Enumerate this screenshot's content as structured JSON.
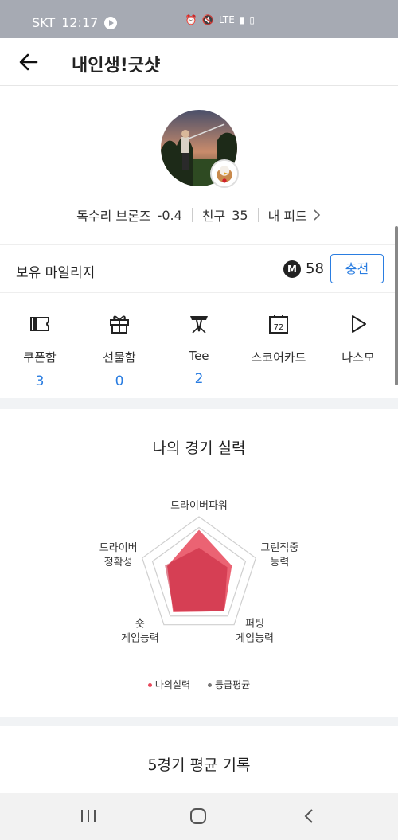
{
  "status": {
    "carrier": "SKT",
    "time": "12:17",
    "network": "LTE"
  },
  "header": {
    "title": "내인생!긋샷"
  },
  "profile": {
    "grade": "독수리 브론즈",
    "grade_value": "-0.4",
    "friends_label": "친구",
    "friends_count": "35",
    "feed_label": "내 피드"
  },
  "mileage": {
    "label": "보유 마일리지",
    "icon_letter": "M",
    "value": "58",
    "charge_label": "충전"
  },
  "menu": [
    {
      "icon": "ticket-icon",
      "label": "쿠폰함",
      "count": "3"
    },
    {
      "icon": "gift-icon",
      "label": "선물함",
      "count": "0"
    },
    {
      "icon": "tee-icon",
      "label": "Tee",
      "count": "2"
    },
    {
      "icon": "scorecard-icon",
      "label": "스코어카드",
      "count": "",
      "icon_text": "72"
    },
    {
      "icon": "play-icon",
      "label": "나스모",
      "count": ""
    }
  ],
  "skill": {
    "title": "나의 경기 실력",
    "axes": [
      "드라이버파워",
      "그린적중\n능력",
      "퍼팅\n게임능력",
      "숏\n게임능력",
      "드라이버\n정확성"
    ],
    "my_values": [
      0.78,
      0.58,
      0.72,
      0.74,
      0.56
    ],
    "avg_values": [
      0.48,
      0.5,
      0.72,
      0.72,
      0.6
    ],
    "legend_my": "나의실력",
    "legend_avg": "등급평균",
    "colors": {
      "my": "#e8485b",
      "avg": "#c4223a",
      "legend_avg": "#777777"
    }
  },
  "avg5": {
    "title": "5경기 평균 기록"
  }
}
